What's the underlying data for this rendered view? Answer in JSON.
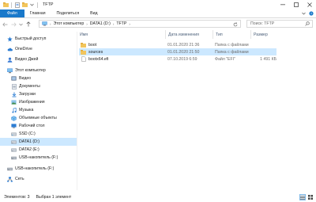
{
  "window": {
    "title": "TFTP"
  },
  "ribbon": {
    "tabs": [
      "Файл",
      "Главная",
      "Поделиться",
      "Вид"
    ]
  },
  "address": {
    "crumbs": [
      "Этот компьютер",
      "DATA1 (D:)",
      "TFTP"
    ]
  },
  "search": {
    "placeholder": "Поиск: TFTP"
  },
  "nav": {
    "items": [
      {
        "label": "Быстрый доступ",
        "icon": "star-icon"
      },
      {
        "label": "OneDrive",
        "icon": "cloud-icon"
      },
      {
        "label": "Видео Джей",
        "icon": "person-icon"
      },
      {
        "label": "Этот компьютер",
        "icon": "computer-icon"
      },
      {
        "label": "Видео",
        "icon": "video-icon"
      },
      {
        "label": "Документы",
        "icon": "documents-icon"
      },
      {
        "label": "Загрузки",
        "icon": "downloads-icon"
      },
      {
        "label": "Изображения",
        "icon": "pictures-icon"
      },
      {
        "label": "Музыка",
        "icon": "music-icon"
      },
      {
        "label": "Объемные объекты",
        "icon": "3d-objects-icon"
      },
      {
        "label": "Рабочий стол",
        "icon": "desktop-icon"
      },
      {
        "label": "SSD (C:)",
        "icon": "drive-icon"
      },
      {
        "label": "DATA1 (D:)",
        "icon": "drive-icon"
      },
      {
        "label": "DATA2 (E:)",
        "icon": "drive-icon"
      },
      {
        "label": "USB-накопитель (F:)",
        "icon": "usb-drive-icon"
      },
      {
        "label": "USB-накопитель (F:)",
        "icon": "usb-drive-icon"
      },
      {
        "label": "Сеть",
        "icon": "network-icon"
      }
    ]
  },
  "columns": {
    "name": "Имя",
    "date": "Дата изменения",
    "type": "Тип",
    "size": "Размер"
  },
  "files": [
    {
      "name": "boot",
      "date": "01.01.2020 21:36",
      "type": "Папка с файлами",
      "size": "",
      "icon": "folder-icon"
    },
    {
      "name": "sources",
      "date": "01.01.2020 21:50",
      "type": "Папка с файлами",
      "size": "",
      "icon": "folder-icon"
    },
    {
      "name": "bootx64.efi",
      "date": "07.10.2019 6:59",
      "type": "Файл \"EFI\"",
      "size": "1 491 КБ",
      "icon": "file-icon"
    }
  ],
  "status": {
    "count": "Элементов: 3",
    "selected": "Выбран 1 элемент"
  },
  "colors": {
    "accent": "#1979ca",
    "selection": "#cce8ff",
    "folder": "#f2c55c"
  }
}
